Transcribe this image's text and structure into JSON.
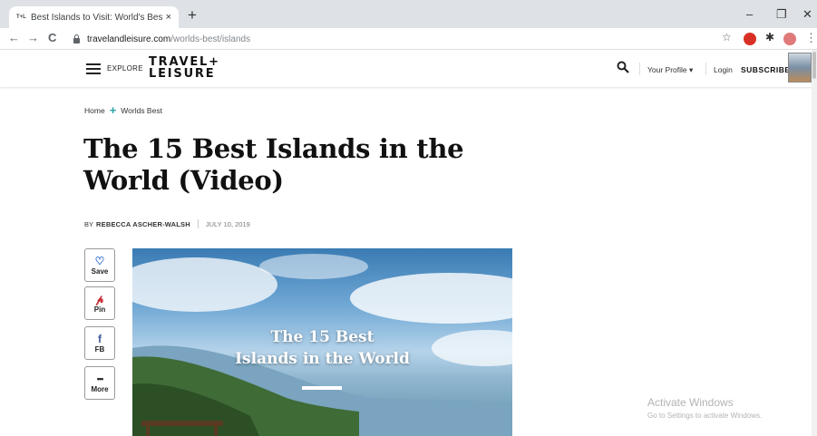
{
  "browser": {
    "tab": {
      "favicon": "T+L",
      "title": "Best Islands to Visit: World's Best",
      "close": "×"
    },
    "new_tab": "+",
    "window_controls": {
      "minimize": "–",
      "maximize": "❐",
      "close": "✕"
    },
    "nav": {
      "back": "←",
      "forward": "→",
      "reload": "C"
    },
    "url_host": "travelandleisure.com",
    "url_path": "/worlds-best/islands",
    "star": "☆",
    "puzzle": "✱",
    "menu": "⋮"
  },
  "header": {
    "explore": "EXPLORE",
    "logo_line1": "TRAVEL+",
    "logo_line2": "LEISURE",
    "profile": "Your Profile",
    "profile_caret": "▾",
    "login": "Login",
    "subscribe": "SUBSCRIBE"
  },
  "breadcrumb": {
    "home": "Home",
    "sep": "+",
    "section": "Worlds Best"
  },
  "article": {
    "title": "The 15 Best Islands in the World (Video)",
    "by": "BY",
    "author": "REBECCA ASCHER-WALSH",
    "date": "JULY 10, 2019"
  },
  "share": [
    {
      "icon": "♡",
      "label": "Save"
    },
    {
      "icon": "𝓅",
      "label": "Pin"
    },
    {
      "icon": "f",
      "label": "FB"
    },
    {
      "icon": "•••",
      "label": "More"
    }
  ],
  "hero": {
    "line1": "The 15 Best",
    "line2": "Islands in the World"
  },
  "watermark": {
    "line1": "Activate Windows",
    "line2": "Go to Settings to activate Windows."
  },
  "colors": {
    "accent": "#2aa3a3",
    "chrome": "#dee1e6"
  }
}
